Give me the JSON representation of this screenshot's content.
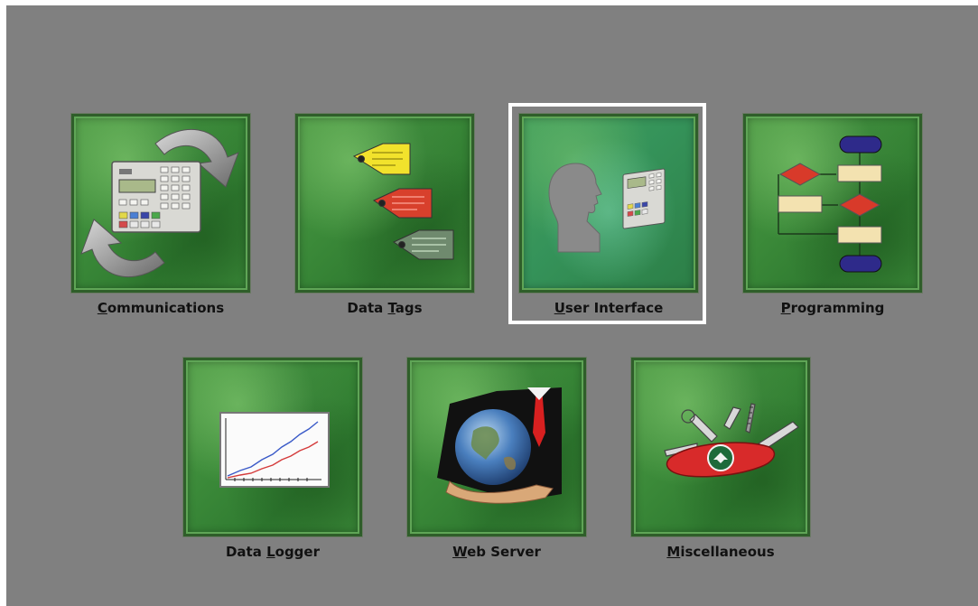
{
  "colors": {
    "background": "#808080",
    "tile_green": "#3b8a39",
    "focus_frame": "#ffffff",
    "label_text": "#111111"
  },
  "focused_item": "User Interface",
  "menu": {
    "communications": {
      "accel": "C",
      "rest": "ommunications",
      "icon": "sync-arrows-device-icon"
    },
    "data_tags": {
      "pre": "Data ",
      "accel": "T",
      "rest": "ags",
      "icon": "price-tags-icon"
    },
    "user_interface": {
      "accel": "U",
      "rest": "ser Interface",
      "icon": "person-silhouette-device-icon"
    },
    "programming": {
      "accel": "P",
      "rest": "rogramming",
      "icon": "flowchart-icon"
    },
    "data_logger": {
      "pre": "Data ",
      "accel": "L",
      "rest": "ogger",
      "icon": "line-graph-icon"
    },
    "web_server": {
      "accel": "W",
      "rest": "eb Server",
      "icon": "globe-in-hands-icon"
    },
    "miscellaneous": {
      "accel": "M",
      "rest": "iscellaneous",
      "icon": "swiss-army-knife-icon"
    }
  }
}
